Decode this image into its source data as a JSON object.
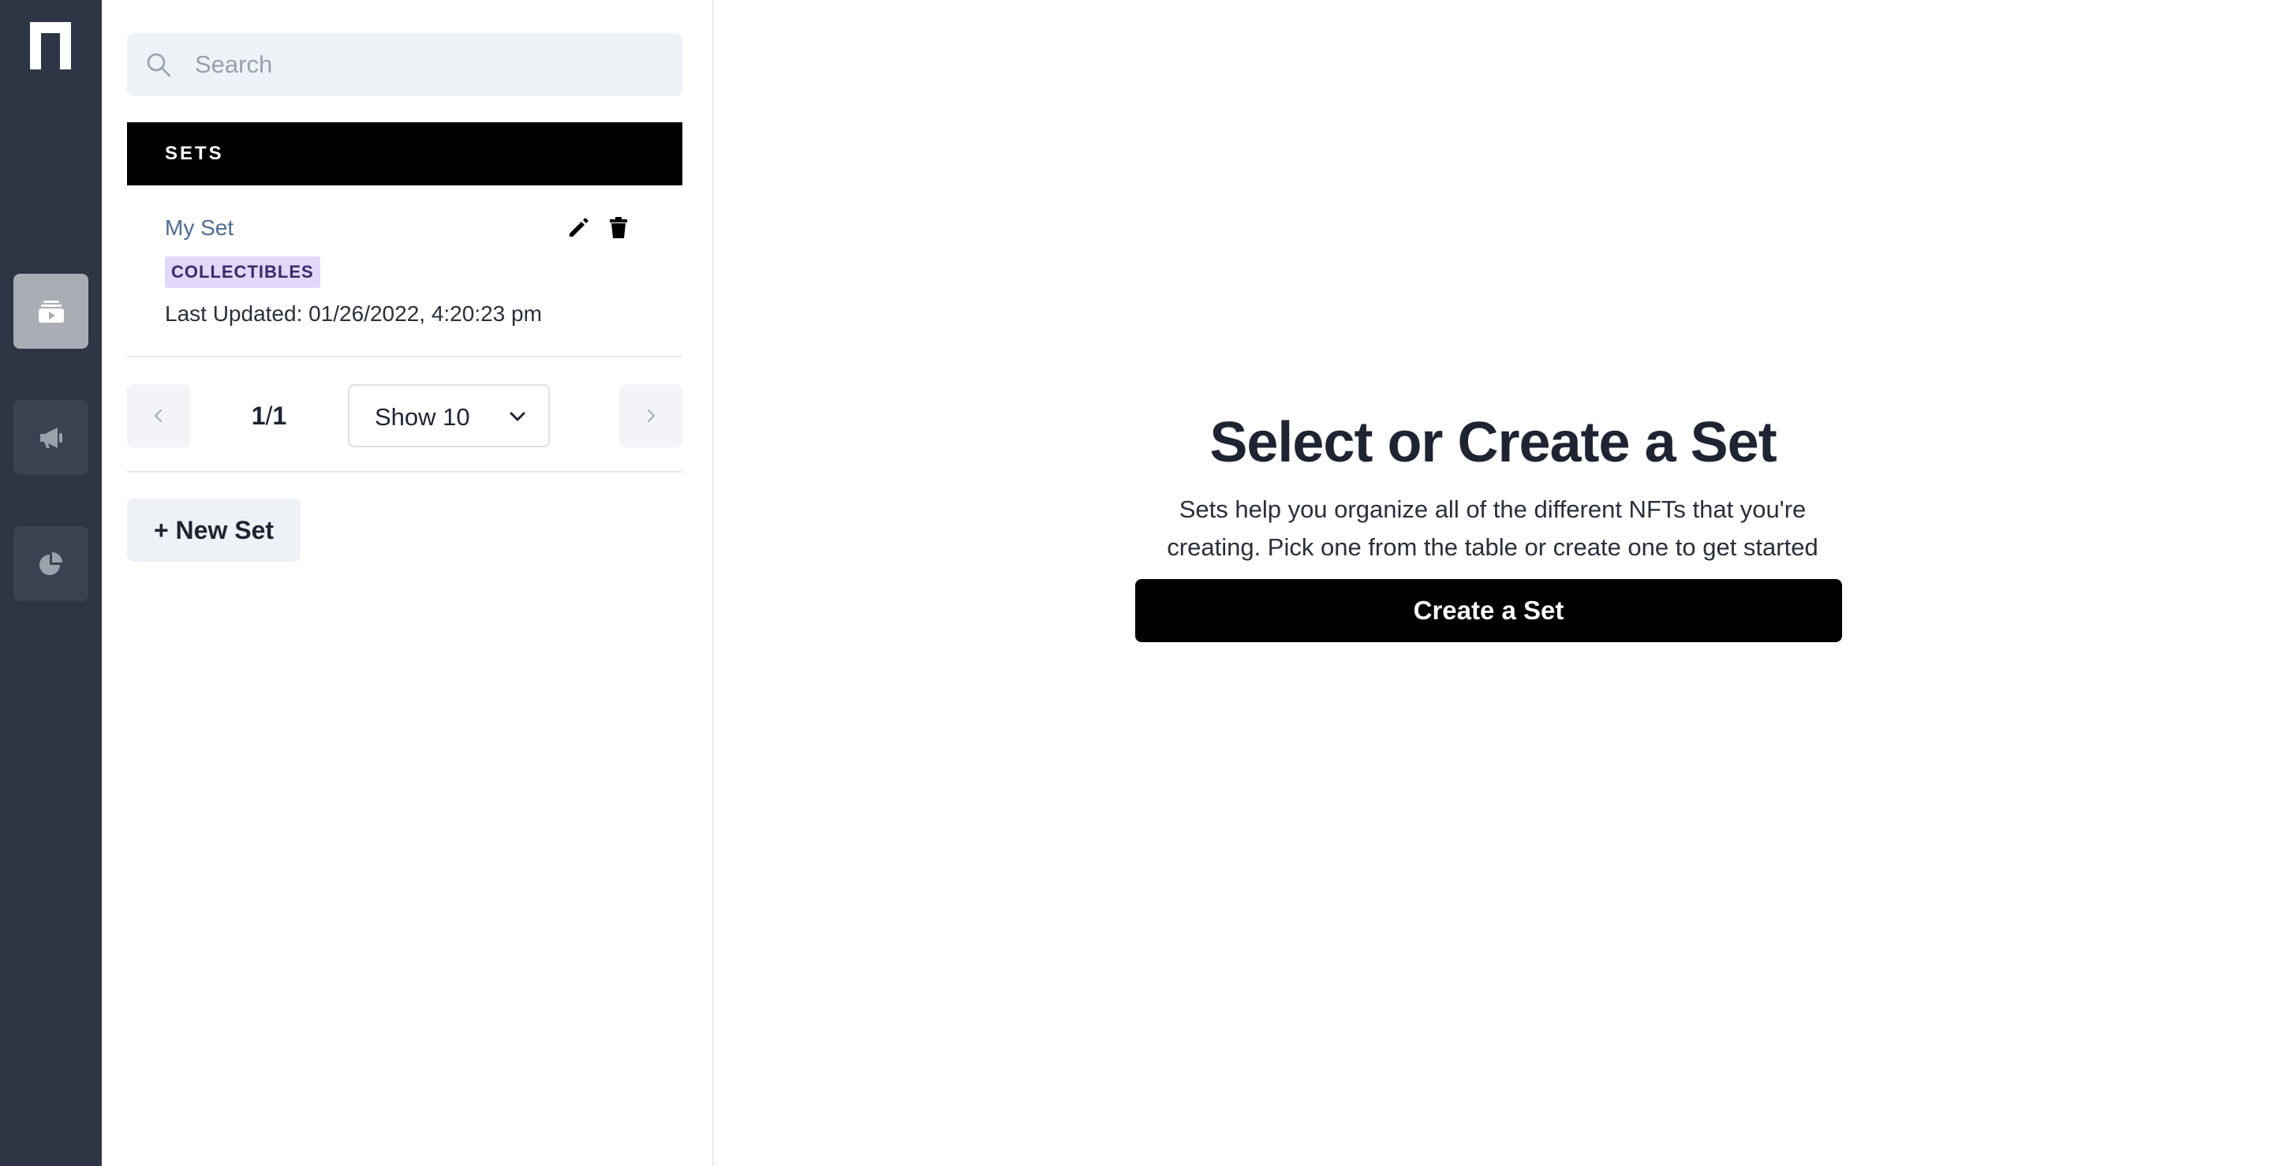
{
  "rail": {
    "logo": "n-logo-icon",
    "items": [
      {
        "icon": "sets-icon",
        "active": true
      },
      {
        "icon": "megaphone-icon",
        "active": false
      },
      {
        "icon": "pie-chart-icon",
        "active": false
      }
    ]
  },
  "search": {
    "placeholder": "Search",
    "value": ""
  },
  "sets_panel": {
    "header": "SETS",
    "items": [
      {
        "name": "My Set",
        "badge": "COLLECTIBLES",
        "last_updated": "Last Updated: 01/26/2022, 4:20:23 pm"
      }
    ],
    "pager": {
      "current": "1",
      "separator": "/",
      "total": "1",
      "page_size_label": "Show 10"
    },
    "new_set_label": "+ New Set"
  },
  "main": {
    "title": "Select or Create a Set",
    "description": "Sets help you organize all of the different NFTs that you're creating. Pick one from the table or create one to get started",
    "create_button": "Create a Set"
  },
  "colors": {
    "rail_bg": "#2e3545",
    "rail_active": "#a9adb4",
    "header_bg": "#000000",
    "badge_bg": "#e3d8fa",
    "link": "#4f6b8f"
  }
}
